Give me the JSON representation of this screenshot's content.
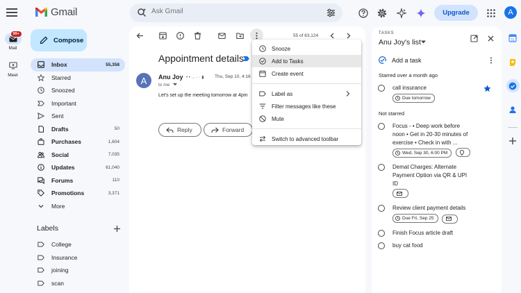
{
  "header": {
    "logo_text": "Gmail",
    "search_placeholder": "Ask Gmail",
    "upgrade_label": "Upgrade",
    "avatar_letter": "A"
  },
  "rail": {
    "mail_label": "Mail",
    "mail_badge": "99+",
    "meet_label": "Meet"
  },
  "nav": {
    "compose_label": "Compose",
    "items": [
      {
        "label": "Inbox",
        "count": "55,358"
      },
      {
        "label": "Starred",
        "count": ""
      },
      {
        "label": "Snoozed",
        "count": ""
      },
      {
        "label": "Important",
        "count": ""
      },
      {
        "label": "Sent",
        "count": ""
      },
      {
        "label": "Drafts",
        "count": "50"
      },
      {
        "label": "Purchases",
        "count": "1,604"
      },
      {
        "label": "Social",
        "count": "7,035"
      },
      {
        "label": "Updates",
        "count": "61,040"
      },
      {
        "label": "Forums",
        "count": "110"
      },
      {
        "label": "Promotions",
        "count": "3,371"
      },
      {
        "label": "More",
        "count": ""
      }
    ],
    "labels_heading": "Labels",
    "labels": [
      "College",
      "Insurance",
      "joining",
      "scan"
    ]
  },
  "mail": {
    "pager": "55 of 63,124",
    "subject": "Appointment details",
    "sender_avatar": "A",
    "sender_name": "Anu Joy",
    "sender_email": "• • ·, ·· · ▮",
    "to_me": "to me",
    "date": "Thu, Sep 10, 4:16",
    "body": "Let's set up the meeting tomorrow at 4pm",
    "reply_label": "Reply",
    "forward_label": "Forward"
  },
  "menu": {
    "items": [
      {
        "label": "Snooze",
        "icon": "clock-icon"
      },
      {
        "label": "Add to Tasks",
        "icon": "add-task-icon"
      },
      {
        "label": "Create event",
        "icon": "calendar-icon"
      },
      {
        "label": "Label as",
        "icon": "label-icon"
      },
      {
        "label": "Filter messages like these",
        "icon": "filter-icon"
      },
      {
        "label": "Mute",
        "icon": "mute-icon"
      },
      {
        "label": "Switch to advanced toolbar",
        "icon": "swap-icon"
      }
    ]
  },
  "tasks": {
    "kicker": "TASKS",
    "list_name": "Anu Joy's list",
    "add_label": "Add a task",
    "starred_section": "Starred over a month ago",
    "not_starred_section": "Not starred",
    "starred_task": {
      "text": "call insurance",
      "chip": "Due tomorrow"
    },
    "task_focus": {
      "text": "Focus - • Deep work before noon • Get in 20-30 minutes of exercise  • Check in with ...",
      "chip": "Wed, Sep 30, 6:00 PM"
    },
    "task_demat": {
      "text": "Demat Charges: Alternate Payment Option via QR & UPI ID"
    },
    "task_review": {
      "text": "Review client payment details",
      "chip": "Due Fri, Sep 25"
    },
    "task_finish": {
      "text": "Finish Focus article draft"
    },
    "task_cat": {
      "text": "buy cat food"
    }
  },
  "colors": {
    "accent": "#0b57d0",
    "compose_bg": "#c2e7ff",
    "active_nav": "#d3e3fd",
    "page_bg": "#f6f8fc"
  }
}
